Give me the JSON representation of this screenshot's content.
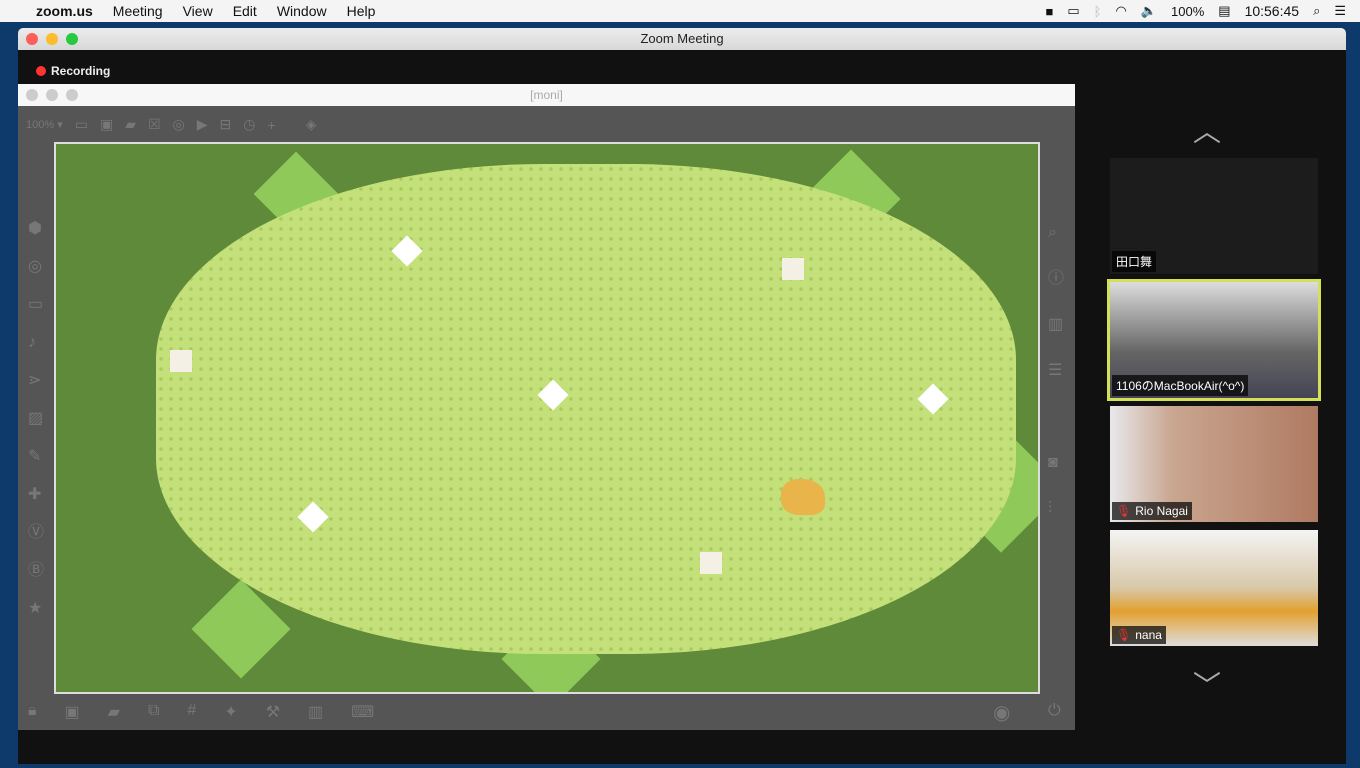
{
  "menubar": {
    "app": "zoom.us",
    "items": [
      "Meeting",
      "View",
      "Edit",
      "Window",
      "Help"
    ],
    "battery": "100%",
    "clock": "10:56:45"
  },
  "window": {
    "title": "Zoom Meeting",
    "recording": "Recording"
  },
  "moni": {
    "title": "[moni]",
    "zoom": "100% ▾"
  },
  "participants": [
    {
      "name": "田口舞",
      "video": false
    },
    {
      "name": "1106のMacBookAir(^o^)",
      "active": true
    },
    {
      "name": "Rio Nagai",
      "muted": true
    },
    {
      "name": "nana",
      "muted": true
    }
  ],
  "colors": {
    "accent_speaker": "#d4e157",
    "recording": "#ff3333"
  }
}
